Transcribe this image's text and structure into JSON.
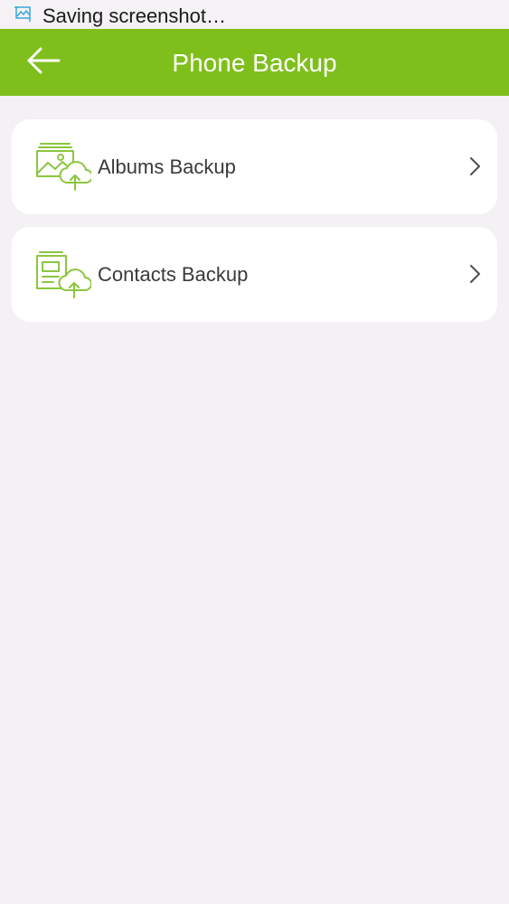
{
  "status_bar": {
    "icon": "screenshot-icon",
    "text": "Saving screenshot…"
  },
  "app_bar": {
    "back_icon": "arrow-left-icon",
    "title": "Phone Backup",
    "color": "#7fbf1c"
  },
  "items": [
    {
      "label": "Albums Backup",
      "icon": "album-cloud-upload-icon",
      "chevron": "chevron-right-icon"
    },
    {
      "label": "Contacts Backup",
      "icon": "contacts-cloud-upload-icon",
      "chevron": "chevron-right-icon"
    }
  ],
  "colors": {
    "accent": "#7fbf1c",
    "background": "#f3f1f3",
    "card": "#ffffff",
    "text": "#3a3a3a"
  }
}
